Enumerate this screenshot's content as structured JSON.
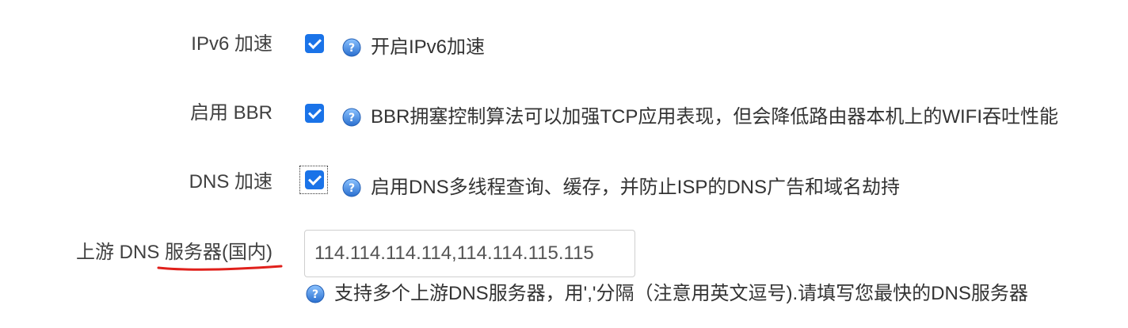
{
  "rows": [
    {
      "label": "IPv6 加速",
      "checked": true,
      "help": "开启IPv6加速"
    },
    {
      "label": "启用 BBR",
      "checked": true,
      "help": "BBR拥塞控制算法可以加强TCP应用表现，但会降低路由器本机上的WIFI吞吐性能"
    },
    {
      "label": "DNS 加速",
      "checked": true,
      "help": "启用DNS多线程查询、缓存，并防止ISP的DNS广告和域名劫持"
    }
  ],
  "upstream_dns": {
    "label": "上游 DNS 服务器(国内)",
    "value": "114.114.114.114,114.114.115.115",
    "help": "支持多个上游DNS服务器，用','分隔（注意用英文逗号).请填写您最快的DNS服务器"
  },
  "colors": {
    "checkbox": "#1a73e8",
    "help_icon": "#3b7dd8",
    "annotation": "#e0201b"
  }
}
